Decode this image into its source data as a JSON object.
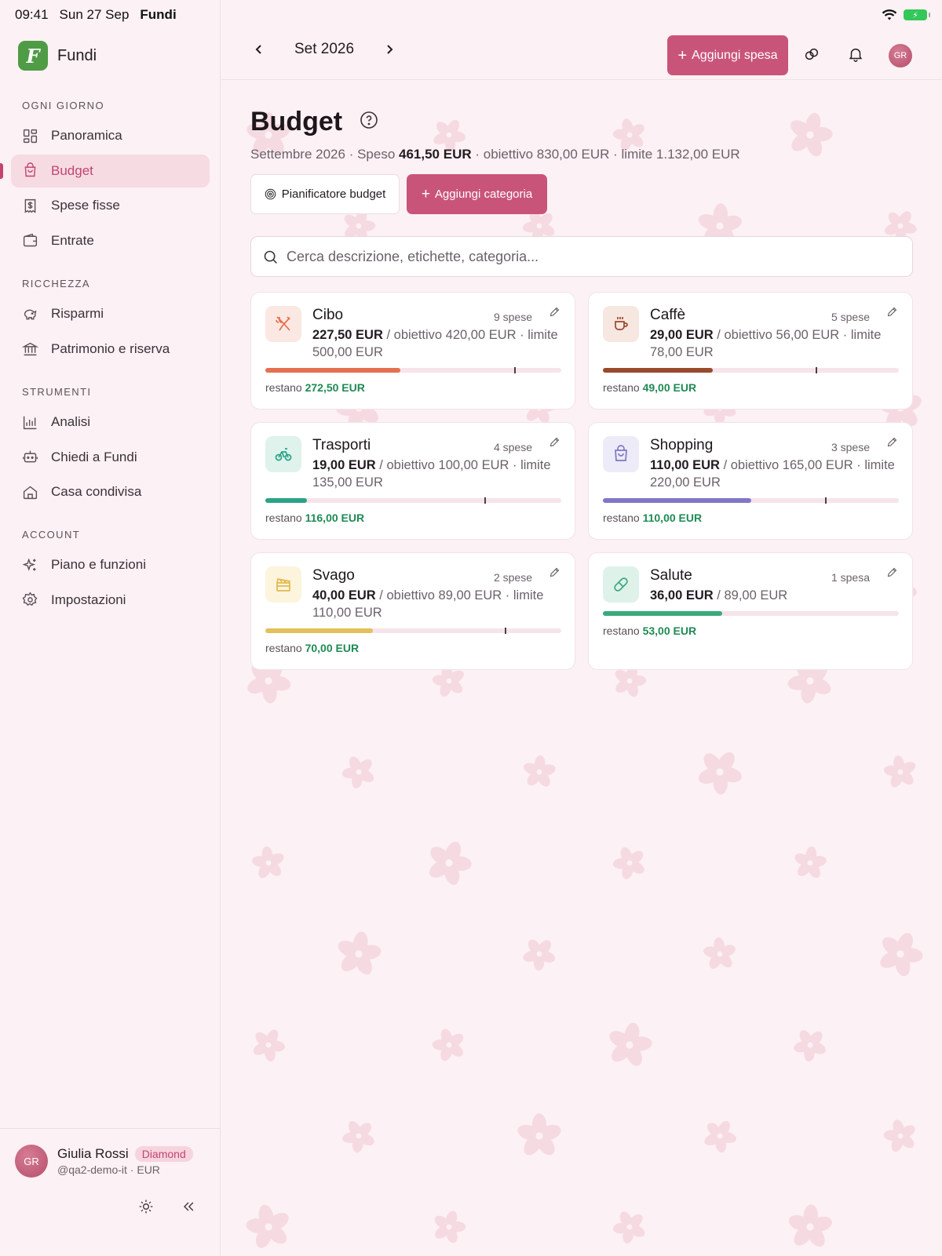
{
  "status_bar": {
    "time": "09:41",
    "date": "Sun 27 Sep",
    "app": "Fundi"
  },
  "brand": {
    "name": "Fundi",
    "logo_letter": "F"
  },
  "sidebar": {
    "sections": [
      {
        "heading": "OGNI GIORNO",
        "items": [
          {
            "label": "Panoramica",
            "icon": "grid-icon"
          },
          {
            "label": "Budget",
            "icon": "bag-icon",
            "active": true
          },
          {
            "label": "Spese fisse",
            "icon": "receipt-icon"
          },
          {
            "label": "Entrate",
            "icon": "wallet-icon"
          }
        ]
      },
      {
        "heading": "RICCHEZZA",
        "items": [
          {
            "label": "Risparmi",
            "icon": "piggy-icon"
          },
          {
            "label": "Patrimonio e riserva",
            "icon": "bank-icon"
          }
        ]
      },
      {
        "heading": "STRUMENTI",
        "items": [
          {
            "label": "Analisi",
            "icon": "chart-icon"
          },
          {
            "label": "Chiedi a Fundi",
            "icon": "bot-icon"
          },
          {
            "label": "Casa condivisa",
            "icon": "home-icon"
          }
        ]
      },
      {
        "heading": "ACCOUNT",
        "items": [
          {
            "label": "Piano e funzioni",
            "icon": "sparkle-icon"
          },
          {
            "label": "Impostazioni",
            "icon": "gear-icon"
          }
        ]
      }
    ]
  },
  "user": {
    "initials": "GR",
    "name": "Giulia Rossi",
    "plan": "Diamond",
    "handle": "@qa2-demo-it · EUR"
  },
  "topbar": {
    "month": "Set 2026",
    "add_expense": "Aggiungi spesa",
    "avatar_initials": "GR"
  },
  "page": {
    "title": "Budget",
    "summary": {
      "prefix": "Settembre 2026 · Speso ",
      "spent": "461,50 EUR",
      "suffix": " · obiettivo 830,00 EUR · limite 1.132,00 EUR"
    },
    "planner_button": "Pianificatore budget",
    "add_category_button": "Aggiungi categoria",
    "search_placeholder": "Cerca descrizione, etichette, categoria..."
  },
  "categories": [
    {
      "name": "Cibo",
      "count": "9 spese",
      "spent": "227,50 EUR",
      "detail": " / obiettivo 420,00 EUR · limite 500,00 EUR",
      "remain_label": "restano",
      "remain": "272,50 EUR",
      "progress": 0.455,
      "target_marker": 0.84,
      "color": "#e5704f",
      "icon_bg": "#fce8e2",
      "icon": "fork-knife-icon"
    },
    {
      "name": "Caffè",
      "count": "5 spese",
      "spent": "29,00 EUR",
      "detail": " / obiettivo 56,00 EUR · limite 78,00 EUR",
      "remain_label": "restano",
      "remain": "49,00 EUR",
      "progress": 0.372,
      "target_marker": 0.718,
      "color": "#9a4a2c",
      "icon_bg": "#f6e7e1",
      "icon": "coffee-cup-icon"
    },
    {
      "name": "Trasporti",
      "count": "4 spese",
      "spent": "19,00 EUR",
      "detail": " / obiettivo 100,00 EUR · limite 135,00 EUR",
      "remain_label": "restano",
      "remain": "116,00 EUR",
      "progress": 0.141,
      "target_marker": 0.741,
      "color": "#2aa387",
      "icon_bg": "#dff2ec",
      "icon": "bicycle-icon"
    },
    {
      "name": "Shopping",
      "count": "3 spese",
      "spent": "110,00 EUR",
      "detail": " / obiettivo 165,00 EUR · limite 220,00 EUR",
      "remain_label": "restano",
      "remain": "110,00 EUR",
      "progress": 0.5,
      "target_marker": 0.75,
      "color": "#8077c8",
      "icon_bg": "#ecebf7",
      "icon": "shopping-bag-icon"
    },
    {
      "name": "Svago",
      "count": "2 spese",
      "spent": "40,00 EUR",
      "detail": " / obiettivo 89,00 EUR · limite 110,00 EUR",
      "remain_label": "restano",
      "remain": "70,00 EUR",
      "progress": 0.364,
      "target_marker": 0.809,
      "color": "#e3c05c",
      "icon_bg": "#fcf4dd",
      "icon": "clapperboard-icon"
    },
    {
      "name": "Salute",
      "count": "1 spesa",
      "spent": "36,00 EUR",
      "detail": " / 89,00 EUR",
      "remain_label": "restano",
      "remain": "53,00 EUR",
      "progress": 0.404,
      "target_marker": null,
      "color": "#3aa97e",
      "icon_bg": "#dff2ea",
      "icon": "pill-icon"
    }
  ]
}
